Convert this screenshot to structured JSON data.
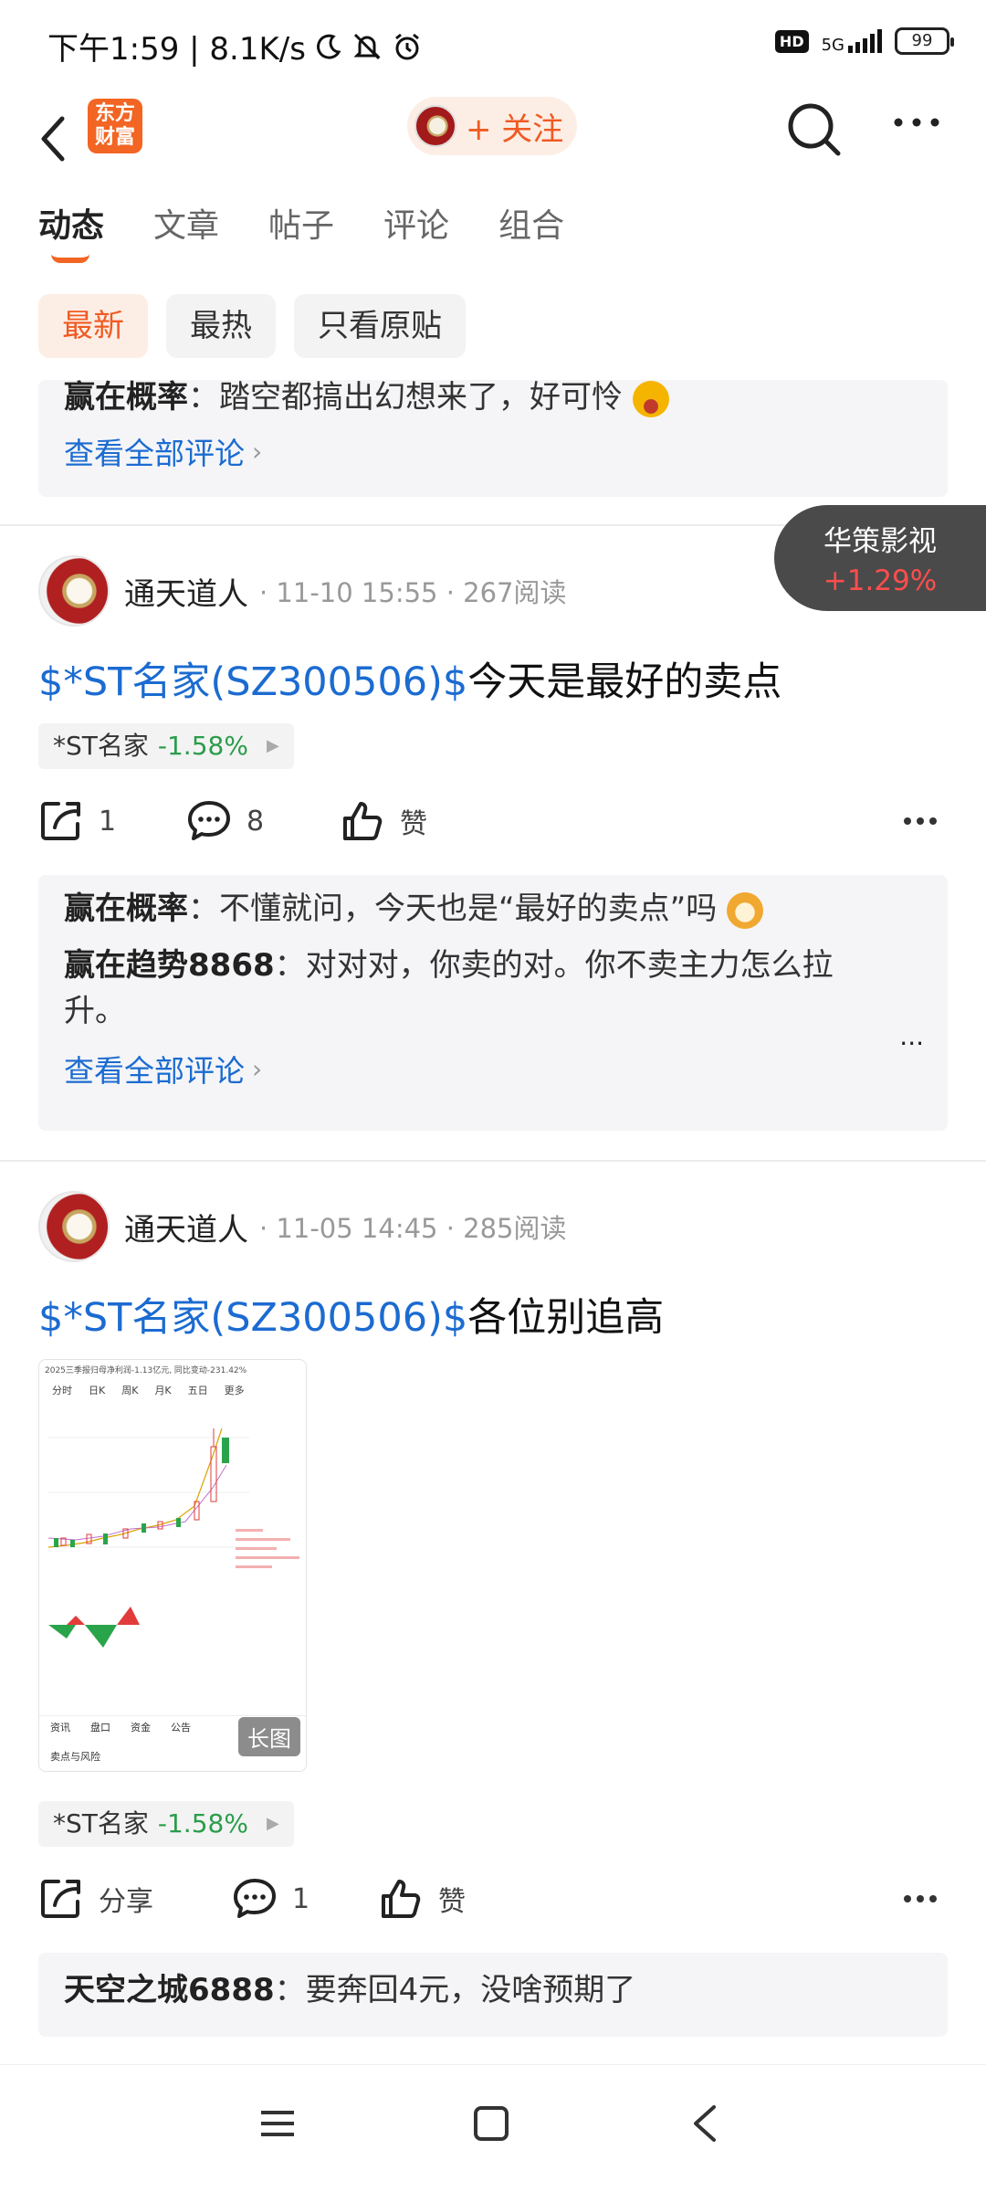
{
  "status_bar": {
    "time_speed": "下午1:59 | 8.1K/s",
    "hd": "HD",
    "network": "5G",
    "battery": "99"
  },
  "header": {
    "logo_text": "东方\n财富",
    "follow_label": "+ 关注"
  },
  "tabs": [
    {
      "label": "动态",
      "active": true
    },
    {
      "label": "文章",
      "active": false
    },
    {
      "label": "帖子",
      "active": false
    },
    {
      "label": "评论",
      "active": false
    },
    {
      "label": "组合",
      "active": false
    }
  ],
  "filters": [
    {
      "label": "最新",
      "active": true
    },
    {
      "label": "最热",
      "active": false
    },
    {
      "label": "只看原贴",
      "active": false
    }
  ],
  "floating_stock": {
    "name": "华策影视",
    "change": "+1.29%"
  },
  "prev_post_comments": {
    "comment": {
      "name": "赢在概率",
      "sep": "：",
      "text": "踏空都搞出幻想来了，好可怜"
    },
    "see_all": "查看全部评论"
  },
  "posts": [
    {
      "author": "通天道人",
      "meta": "· 11-10 15:55 · 267阅读",
      "stock_link": "$*ST名家(SZ300506)$",
      "title_text": "今天是最好的卖点",
      "tag_name": "*ST名家",
      "tag_change": "-1.58%",
      "share_count": "1",
      "comment_count": "8",
      "like_label": "赞",
      "comments": [
        {
          "name": "赢在概率",
          "sep": "：",
          "text": "不懂就问，今天也是“最好的卖点”吗"
        },
        {
          "name": "赢在趋势8868",
          "sep": "：",
          "text": "对对对，你卖的对。你不卖主力怎么拉升。"
        }
      ],
      "comment_more": "...",
      "see_all": "查看全部评论"
    },
    {
      "author": "通天道人",
      "meta": "· 11-05 14:45 · 285阅读",
      "stock_link": "$*ST名家(SZ300506)$",
      "title_text": "各位别追高",
      "image_badge": "长图",
      "image_header": "2025三季报归母净利润-1.13亿元, 同比变动-231.42%",
      "image_tabs": [
        "分时",
        "日K",
        "周K",
        "月K",
        "五日",
        "更多"
      ],
      "image_footer_tabs": [
        "资讯",
        "盘口",
        "资金",
        "公告"
      ],
      "image_footer_label": "卖点与风险",
      "tag_name": "*ST名家",
      "tag_change": "-1.58%",
      "share_label": "分享",
      "comment_count": "1",
      "like_label": "赞",
      "comments": [
        {
          "name": "天空之城6888",
          "sep": "：",
          "text": "要奔回4元，没啥预期了"
        }
      ]
    }
  ],
  "colors": {
    "brand_orange": "#f26522",
    "link_blue": "#1b6bd1",
    "down_green": "#2a9d4b",
    "up_red": "#ff4d4d"
  }
}
